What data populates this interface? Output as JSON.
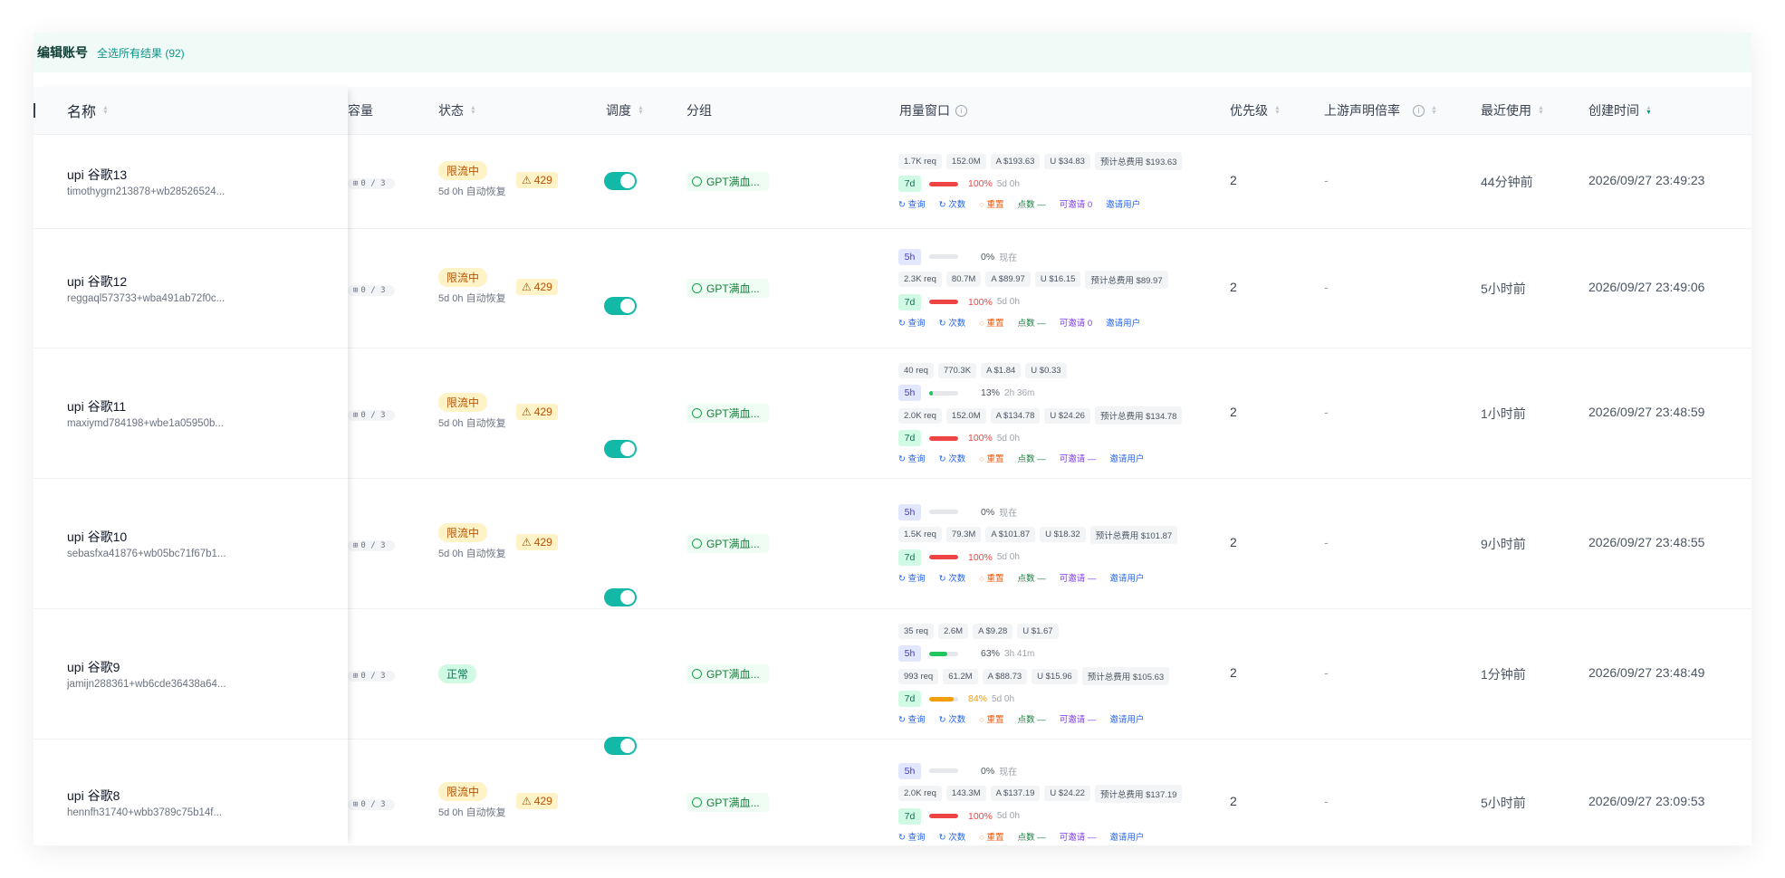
{
  "selection": {
    "title": "编辑账号",
    "select_all": "全选所有结果 (92)"
  },
  "columns": {
    "name": "名称",
    "capacity": "容量",
    "status": "状态",
    "schedule": "调度",
    "group": "分组",
    "usage": "用量窗口",
    "priority": "优先级",
    "upstream": "上游声明倍率",
    "last_used": "最近使用",
    "created": "创建时间"
  },
  "actions": {
    "query": "查询",
    "count": "次数",
    "reset": "重置",
    "points": "点数 —",
    "invite": "可邀请",
    "invited": "邀请用户"
  },
  "rows": [
    {
      "name": "upi 谷歌13",
      "email": "timothygrn213878+wb28526524...",
      "cap": "0 / 3",
      "status": "限流中",
      "auto": "5d 0h 自动恢复",
      "code": "429",
      "group": "GPT满血...",
      "top": {
        "chips": [],
        "h5_pct": "",
        "h5_time": ""
      },
      "d7": {
        "req": "1.7K req",
        "tok": "152.0M",
        "a": "A $193.63",
        "u": "U $34.83",
        "est": "预计总费用 $193.63",
        "pct": "100%",
        "time": "5d 0h",
        "fill": 1.0,
        "color": "#ef4444"
      },
      "invite": "可邀请 0",
      "priority": "2",
      "upstream": "-",
      "last": "44分钟前",
      "created": "2026/09/27 23:49:23"
    },
    {
      "name": "upi 谷歌12",
      "email": "reggaql573733+wba491ab72f0c...",
      "cap": "0 / 3",
      "status": "限流中",
      "auto": "5d 0h 自动恢复",
      "code": "429",
      "group": "GPT满血...",
      "top": {
        "chips": [],
        "h5_pct": "0%",
        "h5_time": "现在",
        "h5_fill": 0
      },
      "d7": {
        "req": "2.3K req",
        "tok": "80.7M",
        "a": "A $89.97",
        "u": "U $16.15",
        "est": "预计总费用 $89.97",
        "pct": "100%",
        "time": "5d 0h",
        "fill": 1.0,
        "color": "#ef4444"
      },
      "invite": "可邀请 0",
      "priority": "2",
      "upstream": "-",
      "last": "5小时前",
      "created": "2026/09/27 23:49:06"
    },
    {
      "name": "upi 谷歌11",
      "email": "maxiymd784198+wbe1a05950b...",
      "cap": "0 / 3",
      "status": "限流中",
      "auto": "5d 0h 自动恢复",
      "code": "429",
      "group": "GPT满血...",
      "top": {
        "chips": [
          "40 req",
          "770.3K",
          "A $1.84",
          "U $0.33"
        ],
        "h5_pct": "13%",
        "h5_time": "2h 36m",
        "h5_fill": 0.13
      },
      "d7": {
        "req": "2.0K req",
        "tok": "152.0M",
        "a": "A $134.78",
        "u": "U $24.26",
        "est": "预计总费用 $134.78",
        "pct": "100%",
        "time": "5d 0h",
        "fill": 1.0,
        "color": "#ef4444"
      },
      "invite": "可邀请 —",
      "priority": "2",
      "upstream": "-",
      "last": "1小时前",
      "created": "2026/09/27 23:48:59"
    },
    {
      "name": "upi 谷歌10",
      "email": "sebasfxa41876+wb05bc71f67b1...",
      "cap": "0 / 3",
      "status": "限流中",
      "auto": "5d 0h 自动恢复",
      "code": "429",
      "group": "GPT满血...",
      "top": {
        "chips": [],
        "h5_pct": "0%",
        "h5_time": "现在",
        "h5_fill": 0
      },
      "d7": {
        "req": "1.5K req",
        "tok": "79.3M",
        "a": "A $101.87",
        "u": "U $18.32",
        "est": "预计总费用 $101.87",
        "pct": "100%",
        "time": "5d 0h",
        "fill": 1.0,
        "color": "#ef4444"
      },
      "invite": "可邀请 —",
      "priority": "2",
      "upstream": "-",
      "last": "9小时前",
      "created": "2026/09/27 23:48:55"
    },
    {
      "name": "upi 谷歌9",
      "email": "jamijn288361+wb6cde36438a64...",
      "cap": "0 / 3",
      "status": "正常",
      "auto": "",
      "code": "",
      "group": "GPT满血...",
      "top": {
        "chips": [
          "35 req",
          "2.6M",
          "A $9.28",
          "U $1.67"
        ],
        "h5_pct": "63%",
        "h5_time": "3h 41m",
        "h5_fill": 0.63
      },
      "d7": {
        "req": "993 req",
        "tok": "61.2M",
        "a": "A $88.73",
        "u": "U $15.96",
        "est": "预计总费用 $105.63",
        "pct": "84%",
        "time": "5d 0h",
        "fill": 0.84,
        "color": "#f59e0b"
      },
      "invite": "可邀请 —",
      "priority": "2",
      "upstream": "-",
      "last": "1分钟前",
      "created": "2026/09/27 23:48:49"
    },
    {
      "name": "upi 谷歌8",
      "email": "hennfh31740+wbb3789c75b14f...",
      "cap": "0 / 3",
      "status": "限流中",
      "auto": "5d 0h 自动恢复",
      "code": "429",
      "group": "GPT满血...",
      "top": {
        "chips": [],
        "h5_pct": "0%",
        "h5_time": "现在",
        "h5_fill": 0
      },
      "d7": {
        "req": "2.0K req",
        "tok": "143.3M",
        "a": "A $137.19",
        "u": "U $24.22",
        "est": "预计总费用 $137.19",
        "pct": "100%",
        "time": "5d 0h",
        "fill": 1.0,
        "color": "#ef4444"
      },
      "invite": "可邀请 —",
      "priority": "2",
      "upstream": "-",
      "last": "5小时前",
      "created": "2026/09/27 23:09:53"
    }
  ]
}
